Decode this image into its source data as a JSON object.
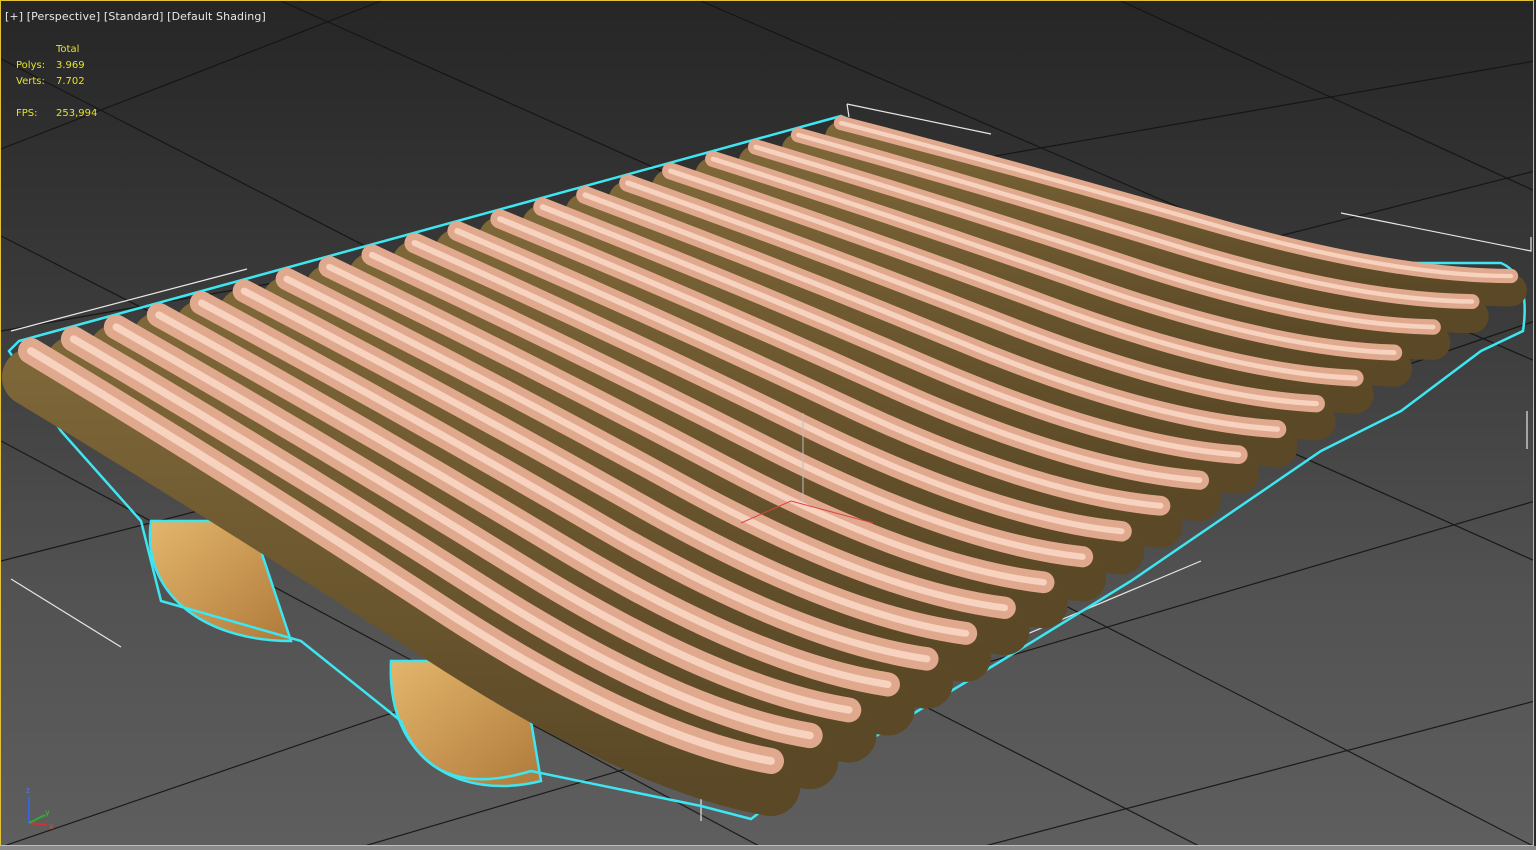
{
  "viewport": {
    "label": {
      "plus": "[+]",
      "view": "[Perspective]",
      "preset": "[Standard]",
      "shading": "[Default Shading]"
    },
    "stats": {
      "header": "Total",
      "polys_label": "Polys:",
      "polys_value": "3.969",
      "verts_label": "Verts:",
      "verts_value": "7.702",
      "fps_label": "FPS:",
      "fps_value": "253,994"
    },
    "axis_tripod": [
      "x",
      "y",
      "z"
    ],
    "colors": {
      "border": "#e4c234",
      "stats_text": "#e6e22c",
      "selection_outline": "#3ee6f2",
      "wood_side": "#6b5a30",
      "wood_top": "#d9a088"
    }
  }
}
